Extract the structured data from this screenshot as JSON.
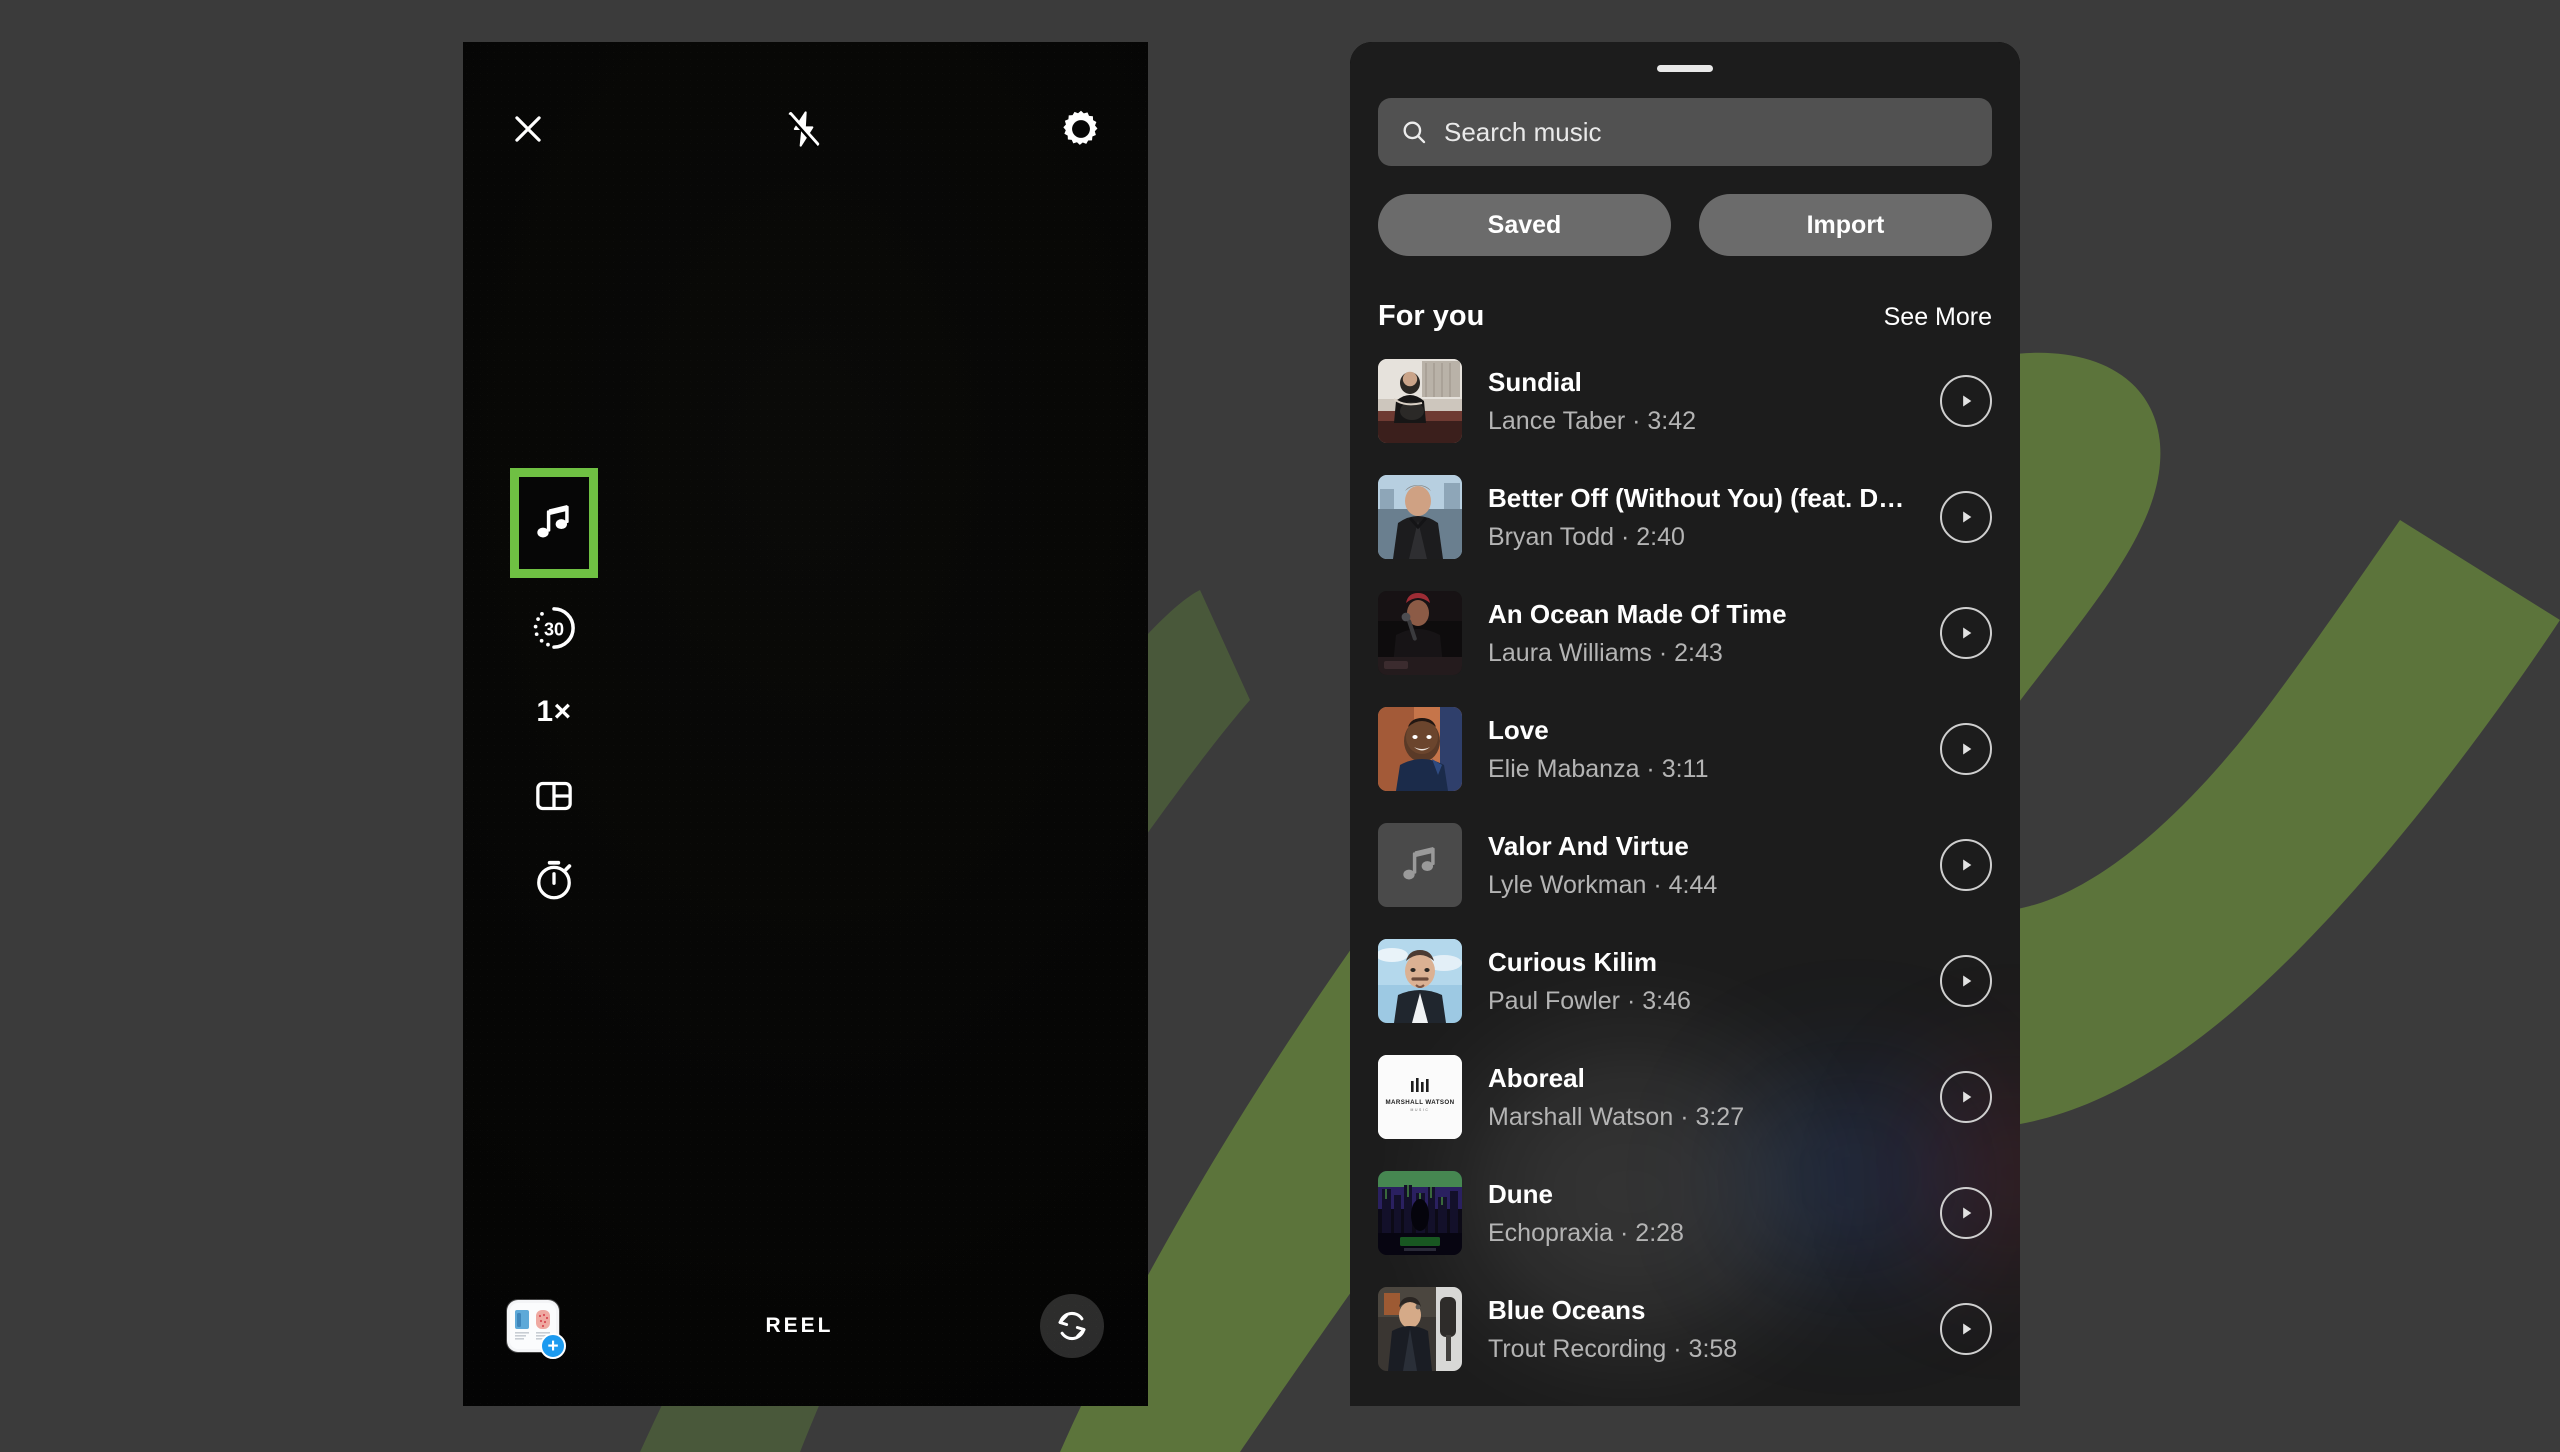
{
  "background": {
    "canvas_color": "#3b3b3b",
    "accent_shape_color": "#5f7a3c"
  },
  "camera": {
    "topbar": {
      "close_icon": "close-icon",
      "flash_icon": "flash-off-icon",
      "settings_icon": "gear-icon"
    },
    "tools": [
      {
        "name": "music",
        "icon": "music-note-icon",
        "label": "",
        "selected": true,
        "highlight_color": "#6fc043"
      },
      {
        "name": "duration",
        "icon": "duration-dial-icon",
        "label": "30",
        "selected": false
      },
      {
        "name": "zoom",
        "icon": "zoom-level-text",
        "label": "1×",
        "selected": false
      },
      {
        "name": "layout",
        "icon": "layout-grid-icon",
        "label": "",
        "selected": false
      },
      {
        "name": "timer",
        "icon": "timer-icon",
        "label": "",
        "selected": false
      }
    ],
    "controls": {
      "effects_icon": "sparkles-icon",
      "shutter": "shutter-button",
      "effect_blue": "blue-dots-effect",
      "effect_pink": "pink-burst-effect"
    },
    "bottombar": {
      "gallery_icon": "gallery-thumbnail",
      "gallery_add_badge": "+",
      "mode_label": "REEL",
      "flip_icon": "camera-flip-icon"
    }
  },
  "music_sheet": {
    "drag_handle": "drag-handle",
    "search": {
      "icon": "search-icon",
      "placeholder": "Search music",
      "value": ""
    },
    "chips": [
      {
        "label": "Saved"
      },
      {
        "label": "Import"
      }
    ],
    "section": {
      "title": "For you",
      "see_more": "See More"
    },
    "tracks": [
      {
        "title": "Sundial",
        "artist": "Lance Taber",
        "duration": "3:42",
        "subtitle": "Lance Taber · 3:42",
        "cover": "photo-guitarist",
        "cover_type": "photo"
      },
      {
        "title": "Better Off (Without You) (feat. Drive D…",
        "artist": "Bryan Todd",
        "duration": "2:40",
        "subtitle": "Bryan Todd · 2:40",
        "cover": "photo-man-leather-jacket",
        "cover_type": "photo"
      },
      {
        "title": "An Ocean Made Of Time",
        "artist": "Laura Williams",
        "duration": "2:43",
        "subtitle": "Laura Williams · 2:43",
        "cover": "photo-singer-stage",
        "cover_type": "photo"
      },
      {
        "title": "Love",
        "artist": "Elie Mabanza",
        "duration": "3:11",
        "subtitle": "Elie Mabanza · 3:11",
        "cover": "photo-portrait-smiling",
        "cover_type": "photo"
      },
      {
        "title": "Valor And Virtue",
        "artist": "Lyle Workman",
        "duration": "4:44",
        "subtitle": "Lyle Workman · 4:44",
        "cover": "music-note-placeholder",
        "cover_type": "placeholder"
      },
      {
        "title": "Curious Kilim",
        "artist": "Paul Fowler",
        "duration": "3:46",
        "subtitle": "Paul Fowler · 3:46",
        "cover": "photo-man-sky",
        "cover_type": "photo"
      },
      {
        "title": "Aboreal",
        "artist": "Marshall Watson",
        "duration": "3:27",
        "subtitle": "Marshall Watson · 3:27",
        "cover": "logo-marshall-watson-music",
        "cover_type": "logo",
        "logo_text": "MARSHALL WATSON"
      },
      {
        "title": "Dune",
        "artist": "Echopraxia",
        "duration": "2:28",
        "subtitle": "Echopraxia · 2:28",
        "cover": "album-art-dune",
        "cover_type": "photo"
      },
      {
        "title": "Blue Oceans",
        "artist": "Trout Recording",
        "duration": "3:58",
        "subtitle": "Trout Recording · 3:58",
        "cover": "photo-man-studio",
        "cover_type": "photo"
      }
    ]
  }
}
